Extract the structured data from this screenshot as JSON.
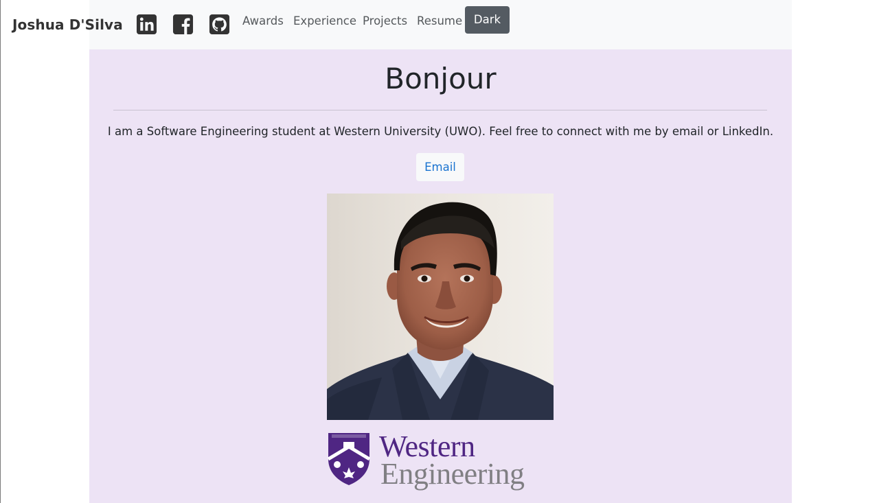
{
  "navbar": {
    "brand": "Joshua D'Silva",
    "social_icons": [
      {
        "name": "linkedin-icon"
      },
      {
        "name": "facebook-icon"
      },
      {
        "name": "github-icon"
      }
    ],
    "links": [
      "Awards",
      "Experience",
      "Projects",
      "Resume"
    ],
    "theme_button_label": "Dark"
  },
  "main": {
    "title": "Bonjour",
    "intro": "I am a Software Engineering student at Western University (UWO). Feel free to connect with me by email or LinkedIn.",
    "email_button_label": "Email",
    "logo": {
      "line1": "Western",
      "line2": "Engineering"
    }
  },
  "colors": {
    "navbar_bg": "#f8f9fa",
    "main_bg": "#ede3f5",
    "western_purple": "#4f2683",
    "logo_grey": "#807f83",
    "dark_button": "#545b62",
    "link_blue": "#1a73d0"
  }
}
